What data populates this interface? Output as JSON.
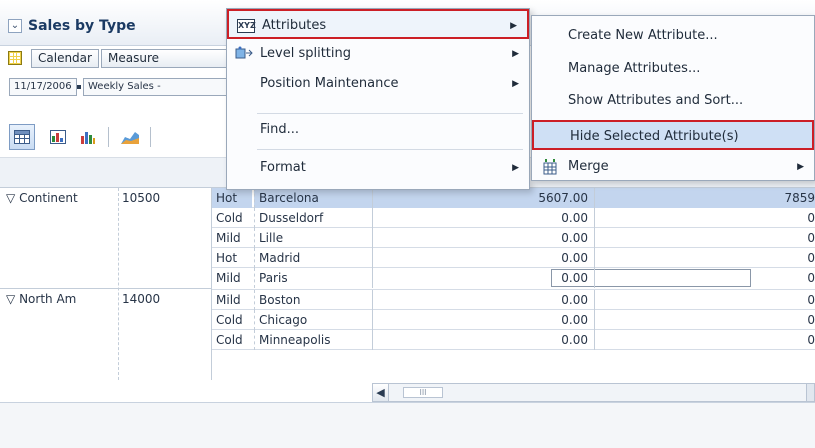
{
  "panel": {
    "title": "Sales by Type",
    "toolbar": {
      "calendar_label": "Calendar",
      "measure_label": "Measure",
      "date_value": "11/17/2006",
      "measure_value": "Weekly Sales -"
    },
    "view_icons": [
      "table-icon",
      "chart-table-icon",
      "bar-chart-icon",
      "area-chart-icon"
    ]
  },
  "grid": {
    "dimensions": [
      {
        "label": "Continent",
        "value": "10500"
      },
      {
        "label": "North Am",
        "value": "14000"
      }
    ],
    "rows": [
      {
        "temp": "Hot",
        "city": "Barcelona",
        "v1": "5607.00",
        "v2": "7859",
        "selected": true
      },
      {
        "temp": "Cold",
        "city": "Dusseldorf",
        "v1": "0.00",
        "v2": "0"
      },
      {
        "temp": "Mild",
        "city": "Lille",
        "v1": "0.00",
        "v2": "0"
      },
      {
        "temp": "Hot",
        "city": "Madrid",
        "v1": "0.00",
        "v2": "0"
      },
      {
        "temp": "Mild",
        "city": "Paris",
        "v1": "0.00",
        "v2": "0",
        "editing": true
      },
      {
        "temp": "Mild",
        "city": "Boston",
        "v1": "0.00",
        "v2": "0"
      },
      {
        "temp": "Cold",
        "city": "Chicago",
        "v1": "0.00",
        "v2": "0"
      },
      {
        "temp": "Cold",
        "city": "Minneapolis",
        "v1": "0.00",
        "v2": "0"
      }
    ],
    "scroll_thumb_glyph": "III"
  },
  "context_menu": {
    "items": [
      {
        "label": "Attributes",
        "icon": "xyz-attributes-icon",
        "icon_text": "XYZ",
        "submenu": true
      },
      {
        "label": "Level splitting",
        "icon": "level-splitting-icon",
        "submenu": true
      },
      {
        "label": "Position Maintenance",
        "submenu": true
      },
      {
        "label": "Find...",
        "submenu": false
      },
      {
        "label": "Format",
        "submenu": true
      }
    ]
  },
  "attributes_submenu": {
    "items": [
      {
        "label": "Create New Attribute..."
      },
      {
        "label": "Manage Attributes..."
      },
      {
        "label": "Show Attributes and Sort..."
      },
      {
        "label": "Hide Selected Attribute(s)"
      },
      {
        "label": "Merge",
        "icon": "merge-icon",
        "submenu": true
      }
    ]
  },
  "colors": {
    "highlight_border": "#cc1f26",
    "selected_row": "#c3d5ee",
    "title": "#1b3a63"
  }
}
